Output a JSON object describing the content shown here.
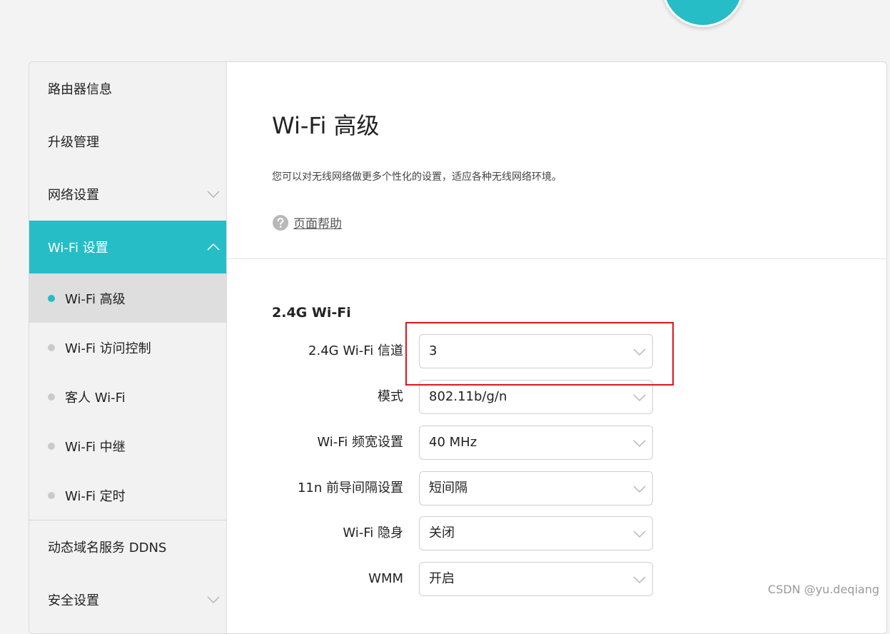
{
  "sidebar": {
    "items": [
      {
        "label": "路由器信息"
      },
      {
        "label": "升级管理"
      },
      {
        "label": "网络设置"
      },
      {
        "label": "Wi-Fi 设置"
      },
      {
        "label": "动态域名服务 DDNS"
      },
      {
        "label": "安全设置"
      }
    ],
    "wifi_sub_items": [
      {
        "label": "Wi-Fi 高级",
        "selected": true
      },
      {
        "label": "Wi-Fi 访问控制",
        "selected": false
      },
      {
        "label": "客人 Wi-Fi",
        "selected": false
      },
      {
        "label": "Wi-Fi 中继",
        "selected": false
      },
      {
        "label": "Wi-Fi 定时",
        "selected": false
      }
    ]
  },
  "main": {
    "title": "Wi-Fi 高级",
    "description": "您可以对无线网络做更多个性化的设置，适应各种无线网络环境。",
    "help_label": "页面帮助",
    "section_title": "2.4G Wi-Fi",
    "fields": [
      {
        "label": "2.4G Wi-Fi 信道",
        "value": "3"
      },
      {
        "label": "模式",
        "value": "802.11b/g/n"
      },
      {
        "label": "Wi-Fi 频宽设置",
        "value": "40 MHz"
      },
      {
        "label": "11n 前导间隔设置",
        "value": "短间隔"
      },
      {
        "label": "Wi-Fi 隐身",
        "value": "关闭"
      },
      {
        "label": "WMM",
        "value": "开启"
      }
    ]
  },
  "colors": {
    "accent": "#27bdc6",
    "highlight_border": "#e0141d",
    "background": "#f3f3f3"
  },
  "watermark": "CSDN @yu.deqiang"
}
